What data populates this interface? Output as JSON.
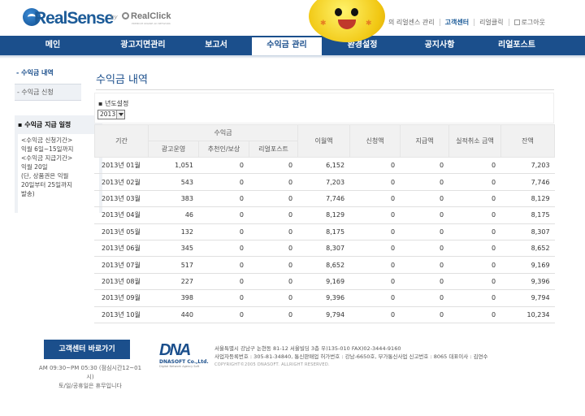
{
  "brand": {
    "logo_text": "RealSense",
    "by_text": "by",
    "partner_name": "RealClick",
    "partner_sub": "PREMIUM ONLINE AD NETWORK"
  },
  "util_links": [
    "리얼센스 관리",
    "고객센터",
    "리얼클릭",
    "로그아웃"
  ],
  "util_visible_prefix": "의 리얼센스 관리",
  "nav": [
    "메인",
    "광고지면관리",
    "보고서",
    "수익금 관리",
    "환경설정",
    "공지사항",
    "리얼포스트"
  ],
  "nav_active": "수익금 관리",
  "sidebar": {
    "current": "- 수익금 내역",
    "sub_item": "- 수익금 신청",
    "notice_title": "▪ 수익금 지급 일정",
    "notice_body": "<수익금 신청기간>\n익월 6일~15일까지\n<수익금 지급기간>\n익월 20일\n(단, 상품권은 익월\n20일부터 25일까지\n발송)"
  },
  "page": {
    "title": "수익금 내역"
  },
  "filter": {
    "label": "▪ 년도설정",
    "year_value": "2013"
  },
  "table": {
    "headers": {
      "period": "기간",
      "revenue_group": "수익금",
      "revenue_sub": [
        "광고운영",
        "추천인/보상",
        "리얼포스트"
      ],
      "carryover": "이월액",
      "requested": "신청액",
      "paid": "지급액",
      "performance_cancel": "실적취소 금액",
      "balance": "잔액"
    },
    "rows": [
      [
        "2013년 01월",
        "1,051",
        "0",
        "0",
        "6,152",
        "0",
        "0",
        "0",
        "7,203"
      ],
      [
        "2013년 02월",
        "543",
        "0",
        "0",
        "7,203",
        "0",
        "0",
        "0",
        "7,746"
      ],
      [
        "2013년 03월",
        "383",
        "0",
        "0",
        "7,746",
        "0",
        "0",
        "0",
        "8,129"
      ],
      [
        "2013년 04월",
        "46",
        "0",
        "0",
        "8,129",
        "0",
        "0",
        "0",
        "8,175"
      ],
      [
        "2013년 05월",
        "132",
        "0",
        "0",
        "8,175",
        "0",
        "0",
        "0",
        "8,307"
      ],
      [
        "2013년 06월",
        "345",
        "0",
        "0",
        "8,307",
        "0",
        "0",
        "0",
        "8,652"
      ],
      [
        "2013년 07월",
        "517",
        "0",
        "0",
        "8,652",
        "0",
        "0",
        "0",
        "9,169"
      ],
      [
        "2013년 08월",
        "227",
        "0",
        "0",
        "9,169",
        "0",
        "0",
        "0",
        "9,396"
      ],
      [
        "2013년 09월",
        "398",
        "0",
        "0",
        "9,396",
        "0",
        "0",
        "0",
        "9,794"
      ],
      [
        "2013년 10월",
        "440",
        "0",
        "0",
        "9,794",
        "0",
        "0",
        "0",
        "10,234"
      ]
    ]
  },
  "footer": {
    "button": "고객센터 바로가기",
    "hours": "AM 09:30~PM 05:30 (점심시간12~01시)\n토/일/공휴일은 휴무입니다",
    "company_mark": "DNA",
    "company_name": "DNASOFT Co.,Ltd.",
    "company_tag": "Digital Network Agency Soft",
    "address": "서울특별시 강남구 논현동 81-12 서울빌딩 3층  우)135-010  FAX)02-3444-9160",
    "registration": "사업자등록번호 : 305-81-34840, 통신판매업 허가번호 : 강남-6650호, 부가통신사업 신고번호 : 8065  대표이사 : 김연수",
    "copyright": "COPYRIGHT©2005 DNASOFT. ALLRIGHT RESERVED."
  },
  "colors": {
    "brand_blue": "#1b4f8c",
    "header_grey": "#f1f1f1",
    "mascot_yellow": "#f1c712"
  },
  "icons": [
    "realsense-logo-icon",
    "realclick-logo-icon",
    "mascot-smiley-icon",
    "logout-box-icon",
    "select-arrow-icon"
  ]
}
